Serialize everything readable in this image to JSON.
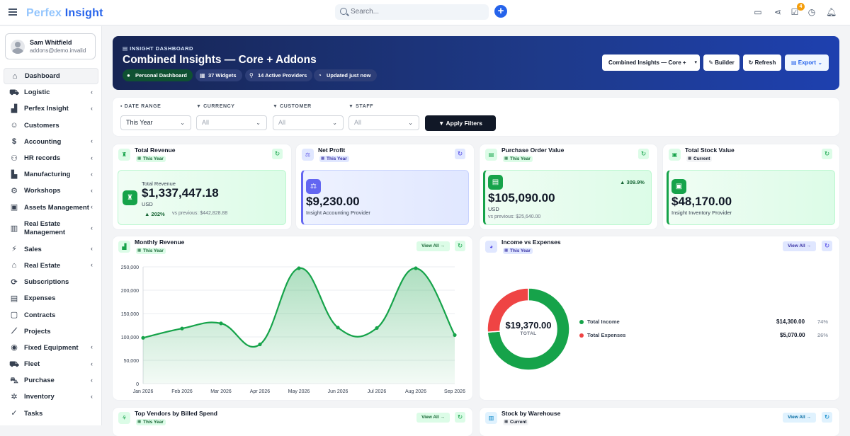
{
  "topbar": {
    "logo_light": "Perfex",
    "logo_dark": "Insight",
    "search_placeholder": "Search...",
    "notification_count": "4",
    "icons": [
      "menu-icon",
      "search-icon",
      "plus-icon",
      "id-card-icon",
      "share-icon",
      "checklist-icon",
      "clock-icon",
      "bell-icon"
    ]
  },
  "user": {
    "name": "Sam Whitfield",
    "email": "addons@demo.invalid"
  },
  "sidebar": {
    "items": [
      {
        "label": "Dashboard",
        "icon": "home-icon",
        "active": true
      },
      {
        "label": "Logistic",
        "icon": "truck-icon",
        "chevron": true
      },
      {
        "label": "Perfex Insight",
        "icon": "chart-icon",
        "chevron": true
      },
      {
        "label": "Customers",
        "icon": "user-icon"
      },
      {
        "label": "Accounting",
        "icon": "dollar-icon",
        "chevron": true
      },
      {
        "label": "HR records",
        "icon": "users-icon",
        "chevron": true
      },
      {
        "label": "Manufacturing",
        "icon": "factory-icon",
        "chevron": true
      },
      {
        "label": "Workshops",
        "icon": "cog-icon",
        "chevron": true
      },
      {
        "label": "Assets Management",
        "icon": "box-icon",
        "chevron": true
      },
      {
        "label": "Real Estate Management",
        "icon": "building-icon",
        "chevron": true
      },
      {
        "label": "Sales",
        "icon": "bolt-icon",
        "chevron": true
      },
      {
        "label": "Real Estate",
        "icon": "house-icon",
        "chevron": true
      },
      {
        "label": "Subscriptions",
        "icon": "repeat-icon"
      },
      {
        "label": "Expenses",
        "icon": "file-icon"
      },
      {
        "label": "Contracts",
        "icon": "document-icon"
      },
      {
        "label": "Projects",
        "icon": "graph-icon"
      },
      {
        "label": "Fixed Equipment",
        "icon": "disc-icon",
        "chevron": true
      },
      {
        "label": "Fleet",
        "icon": "car-icon",
        "chevron": true
      },
      {
        "label": "Purchase",
        "icon": "cart-icon",
        "chevron": true
      },
      {
        "label": "Inventory",
        "icon": "gear-icon",
        "chevron": true
      },
      {
        "label": "Tasks",
        "icon": "check-circle-icon"
      }
    ]
  },
  "hero": {
    "kicker": "INSIGHT DASHBOARD",
    "title": "Combined Insights — Core + Addons",
    "pills": [
      "Personal Dashboard",
      "37 Widgets",
      "14 Active Providers",
      "Updated just now"
    ],
    "select_value": "Combined Insights — Core +",
    "builder": "Builder",
    "refresh": "Refresh",
    "export": "Export"
  },
  "filters": {
    "date_label": "DATE RANGE",
    "date_value": "This Year",
    "currency_label": "CURRENCY",
    "currency_value": "All",
    "customer_label": "CUSTOMER",
    "customer_value": "All",
    "staff_label": "STAFF",
    "staff_value": "All",
    "apply": "Apply Filters"
  },
  "kpis": [
    {
      "title": "Total Revenue",
      "sub": "This Year",
      "inner_label": "Total Revenue",
      "value": "$1,337,447.18",
      "currency": "USD",
      "change": "202%",
      "previous": "vs previous: $442,828.88",
      "accent": "#16a34a"
    },
    {
      "title": "Net Profit",
      "sub": "This Year",
      "value": "$9,230.00",
      "provider": "Insight Accounting Provider",
      "accent": "#6366f1"
    },
    {
      "title": "Purchase Order Value",
      "sub": "This Year",
      "value": "$105,090.00",
      "currency": "USD",
      "change": "309.9%",
      "previous": "vs previous: $25,640.00",
      "accent": "#16a34a"
    },
    {
      "title": "Total Stock Value",
      "sub": "Current",
      "value": "$48,170.00",
      "provider": "Insight Inventory Provider",
      "accent": "#16a34a"
    }
  ],
  "monthly": {
    "title": "Monthly Revenue",
    "sub": "This Year",
    "view_all": "View All →"
  },
  "income": {
    "title": "Income vs Expenses",
    "sub": "This Year",
    "view_all": "View All →",
    "center_value": "$19,370.00",
    "center_label": "TOTAL",
    "rows": [
      {
        "label": "Total Income",
        "value": "$14,300.00",
        "pct": "74%",
        "color": "#16a34a"
      },
      {
        "label": "Total Expenses",
        "value": "$5,070.00",
        "pct": "26%",
        "color": "#ef4444"
      }
    ]
  },
  "vendors": {
    "title": "Top Vendors by Billed Spend",
    "sub": "This Year",
    "view_all": "View All →"
  },
  "warehouse": {
    "title": "Stock by Warehouse",
    "sub": "Current",
    "view_all": "View All →"
  },
  "chart_data": [
    {
      "type": "area",
      "title": "Monthly Revenue",
      "categories": [
        "Jan 2026",
        "Feb 2026",
        "Mar 2026",
        "Apr 2026",
        "May 2026",
        "Jun 2026",
        "Jul 2026",
        "Aug 2026",
        "Sep 2026"
      ],
      "series": [
        {
          "values": [
            98000,
            118000,
            129000,
            84000,
            247000,
            120000,
            119000,
            247000,
            104000
          ]
        }
      ],
      "ylim": [
        0,
        250000
      ],
      "yticks": [
        "0",
        "50,000",
        "100,000",
        "150,000",
        "200,000",
        "250,000"
      ],
      "color": "#16a34a",
      "grid": true
    },
    {
      "type": "pie",
      "title": "Income vs Expenses",
      "categories": [
        "Total Income",
        "Total Expenses"
      ],
      "values": [
        14300,
        5070
      ],
      "colors": [
        "#16a34a",
        "#ef4444"
      ]
    }
  ]
}
